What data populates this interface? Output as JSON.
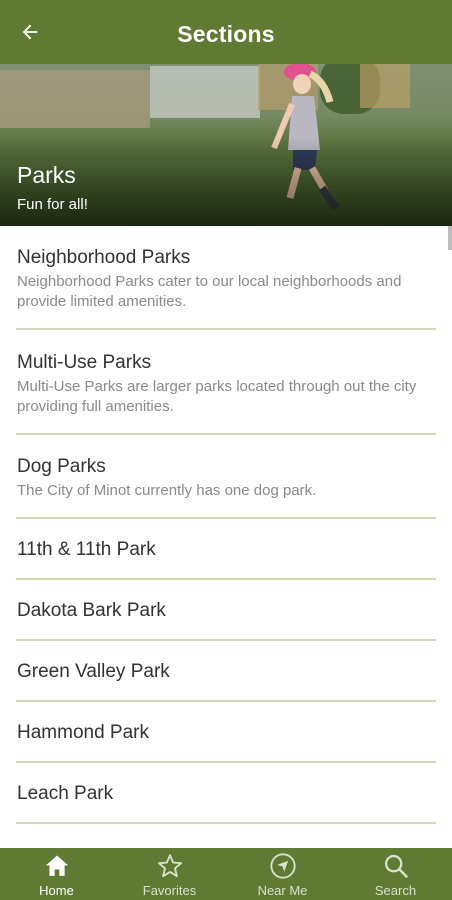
{
  "appbar": {
    "title": "Sections",
    "back_icon": "arrow-left-icon"
  },
  "hero": {
    "title": "Parks",
    "subtitle": "Fun for all!"
  },
  "list": [
    {
      "title": "Neighborhood Parks",
      "desc": "Neighborhood Parks cater to our local neighborhoods and provide limited amenities."
    },
    {
      "title": "Multi-Use Parks",
      "desc": "Multi-Use Parks are larger parks located through out the city providing full amenities."
    },
    {
      "title": "Dog Parks",
      "desc": "The City of Minot currently has one dog park."
    },
    {
      "title": "11th & 11th Park"
    },
    {
      "title": "Dakota Bark Park"
    },
    {
      "title": "Green Valley Park"
    },
    {
      "title": "Hammond Park"
    },
    {
      "title": "Leach Park"
    }
  ],
  "bottom_nav": [
    {
      "label": "Home",
      "icon": "home-icon",
      "active": true
    },
    {
      "label": "Favorites",
      "icon": "star-icon",
      "active": false
    },
    {
      "label": "Near Me",
      "icon": "navigation-icon",
      "active": false
    },
    {
      "label": "Search",
      "icon": "search-icon",
      "active": false
    }
  ],
  "colors": {
    "primary": "#5f7a33",
    "divider": "#d5d6b6",
    "text": "#333333",
    "secondary_text": "#8a8a8a"
  }
}
